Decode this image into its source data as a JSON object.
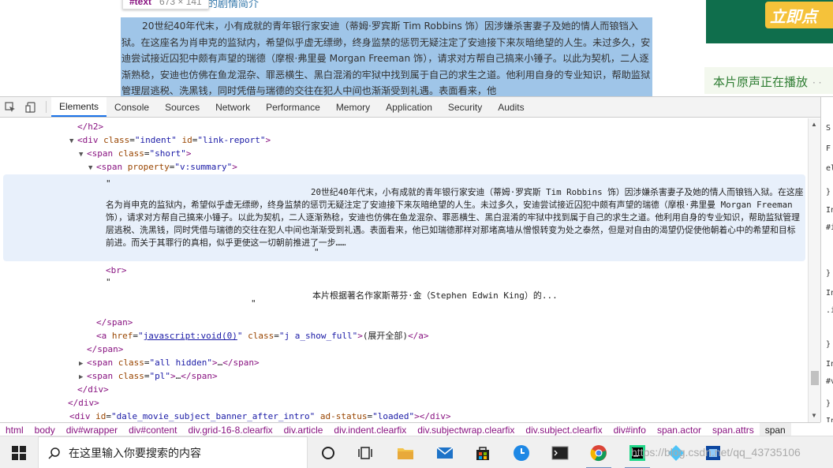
{
  "page": {
    "tooltip_tag": "#text",
    "tooltip_size": "673 × 141",
    "heading_fragment": "的剧情简介",
    "summary_text": "20世纪40年代末，小有成就的青年银行家安迪（蒂姆·罗宾斯 Tim Robbins 饰）因涉嫌杀害妻子及她的情人而锒铛入狱。在这座名为肖申克的监狱内，希望似乎虚无缥缈，终身监禁的惩罚无疑注定了安迪接下来灰暗绝望的人生。未过多久，安迪尝试接近囚犯中颇有声望的瑞德（摩根·弗里曼 Morgan Freeman 饰），请求对方帮自己搞来小锤子。以此为契机，二人逐渐熟稔，安迪也仿佛在鱼龙混杂、罪恶横生、黑白混淆的牢狱中找到属于自己的求生之道。他利用自身的专业知识，帮助监狱管理层逃税、洗黑钱，同时凭借与瑞德的交往在犯人中间也渐渐受到礼遇。表面看来，他",
    "ad_button": "立即点",
    "soundtrack": "本片原声正在播放",
    "soundtrack_dots": "· ·"
  },
  "devtools": {
    "tabs": [
      "Elements",
      "Console",
      "Sources",
      "Network",
      "Performance",
      "Memory",
      "Application",
      "Security",
      "Audits"
    ],
    "active_tab": "Elements",
    "dom": {
      "l0": "</h2>",
      "l1_tag": "div",
      "l1_attr1": "class",
      "l1_val1": "indent",
      "l1_attr2": "id",
      "l1_val2": "link-report",
      "l2_tag": "span",
      "l2_attr": "class",
      "l2_val": "short",
      "l3_tag": "span",
      "l3_attr": "property",
      "l3_val": "v:summary",
      "quote": "\"",
      "summary_node": "20世纪40年代末，小有成就的青年银行家安迪（蒂姆·罗宾斯 Tim Robbins 饰）因涉嫌杀害妻子及她的情人而锒铛入狱。在这座名为肖申克的监狱内，希望似乎虚无缥缈，终身监禁的惩罚无疑注定了安迪接下来灰暗绝望的人生。未过多久，安迪尝试接近囚犯中颇有声望的瑞德（摩根·弗里曼 Morgan Freeman 饰），请求对方帮自己搞来小锤子。以此为契机，二人逐渐熟稔，安迪也仿佛在鱼龙混杂、罪恶横生、黑白混淆的牢狱中找到属于自己的求生之道。他利用自身的专业知识，帮助监狱管理层逃税、洗黑钱，同时凭借与瑞德的交往在犯人中间也渐渐受到礼遇。表面看来，他已如瑞德那样对那堵高墙从憎恨转变为处之泰然，但是对自由的渴望仍促使他朝着心中的希望和目标前进。而关于其罪行的真相，似乎更使这一切朝前推进了一步……",
      "br": "<br>",
      "more_node": "本片根据著名作家斯蒂芬·金（Stephen Edwin King）的...",
      "close_span": "</span>",
      "a_attr": "href",
      "a_val": "javascript:void(0)",
      "a_attr2": "class",
      "a_val2": "j a_show_full",
      "a_text": "(展开全部)",
      "hidden_attr": "class",
      "hidden_val": "all hidden",
      "ellipsis": "…",
      "pl_val": "pl",
      "close_div": "</div>",
      "last_id_attr": "id",
      "last_id_val": "dale_movie_subject_banner_after_intro",
      "last_ad_attr": "ad-status",
      "last_ad_val": "loaded"
    },
    "styles_glimpse": [
      "S",
      "F",
      "el",
      "}",
      "In",
      "#i",
      "}",
      "In",
      ".i",
      "}",
      "In",
      "#v",
      "}",
      "In"
    ],
    "breadcrumbs": [
      "html",
      "body",
      "div#wrapper",
      "div#content",
      "div.grid-16-8.clearfix",
      "div.article",
      "div.indent.clearfix",
      "div.subjectwrap.clearfix",
      "div.subject.clearfix",
      "div#info",
      "span.actor",
      "span.attrs",
      "span"
    ]
  },
  "taskbar": {
    "search_placeholder": "在这里输入你要搜索的内容",
    "watermark": "https://blog.csdn.net/qq_43735106"
  }
}
